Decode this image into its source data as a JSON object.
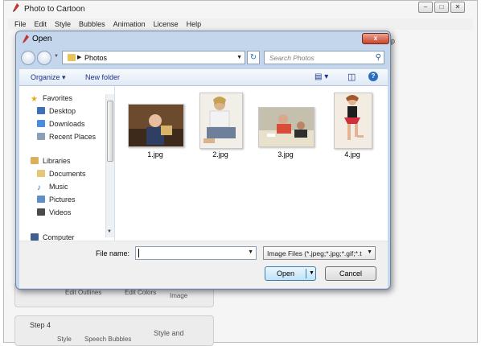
{
  "app": {
    "title": "Photo to Cartoon",
    "menu": [
      "File",
      "Edit",
      "Style",
      "Bubbles",
      "Animation",
      "License",
      "Help"
    ],
    "partial_right_text": "lp",
    "background": {
      "panel_items": [
        "Edit Outlines",
        "Edit Colors",
        "Image"
      ],
      "step_label": "Step 4",
      "step_items": [
        "Style",
        "Speech Bubbles",
        "Style and"
      ]
    }
  },
  "dialog": {
    "title": "Open",
    "close_glyph": "x",
    "address": {
      "folder": "Photos"
    },
    "search": {
      "placeholder": "Search Photos"
    },
    "toolbar": {
      "organize": "Organize",
      "new_folder": "New folder"
    },
    "nav": {
      "favorites_header": "Favorites",
      "favorites": [
        "Desktop",
        "Downloads",
        "Recent Places"
      ],
      "libraries_header": "Libraries",
      "libraries": [
        "Documents",
        "Music",
        "Pictures",
        "Videos"
      ],
      "computer": "Computer"
    },
    "files": [
      {
        "name": "1.jpg"
      },
      {
        "name": "2.jpg"
      },
      {
        "name": "3.jpg"
      },
      {
        "name": "4.jpg"
      }
    ],
    "file_name_label": "File name:",
    "file_name_value": "",
    "filter": "Image Files (*.jpeg;*.jpg;*.gif;*.t",
    "open_label": "Open",
    "cancel_label": "Cancel"
  },
  "colors": {
    "accent": "#2a6fbf",
    "dialog_frame": "#c3d6ec",
    "close_red": "#c9452b"
  }
}
